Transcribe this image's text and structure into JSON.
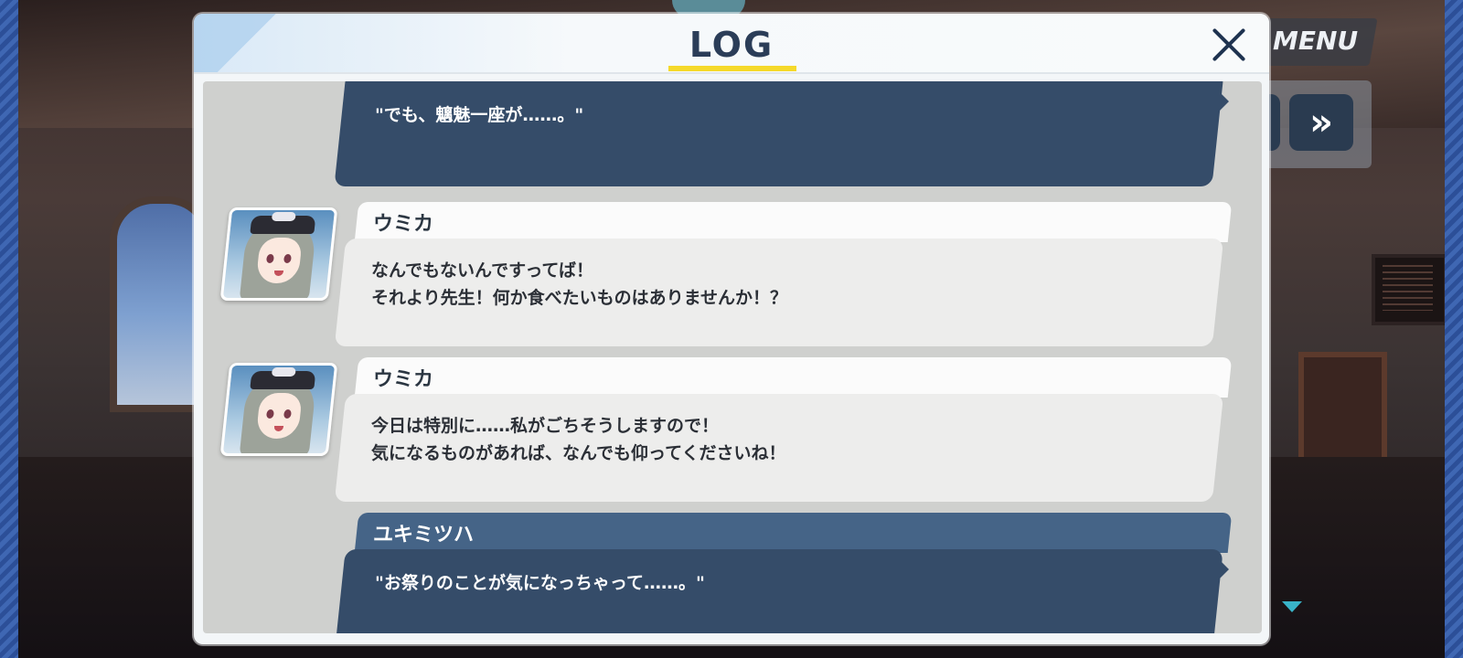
{
  "hud": {
    "menu_label": "MENU",
    "skip_icon": "fast-forward-icon",
    "skip_glyph": "»"
  },
  "dialog": {
    "title": "LOG",
    "close_icon": "close-icon",
    "accent_color": "#f5d92a"
  },
  "entries": [
    {
      "speaker": "",
      "is_player": true,
      "lines": [
        "\"でも、魑魅一座が……。\""
      ]
    },
    {
      "speaker": "ウミカ",
      "is_player": false,
      "avatar": "umika-portrait",
      "lines": [
        "なんでもないんですってば！",
        "それより先生！何か食べたいものはありませんか！？"
      ]
    },
    {
      "speaker": "ウミカ",
      "is_player": false,
      "avatar": "umika-portrait",
      "lines": [
        "今日は特別に……私がごちそうしますので！",
        "気になるものがあれば、なんでも仰ってくださいね！"
      ]
    },
    {
      "speaker": "ユキミツハ",
      "is_player": true,
      "lines": [
        "\"お祭りのことが気になっちゃって……。\""
      ]
    }
  ]
}
